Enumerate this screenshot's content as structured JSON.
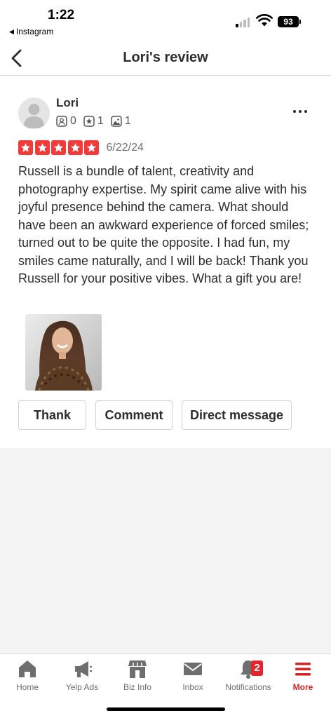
{
  "status_bar": {
    "time": "1:22",
    "back_app": "Instagram",
    "battery": "93"
  },
  "nav": {
    "title": "Lori's review"
  },
  "review": {
    "user_name": "Lori",
    "stats": {
      "friends": "0",
      "reviews": "1",
      "photos": "1"
    },
    "rating": 5,
    "rating_color": "#f43939",
    "date": "6/22/24",
    "text": "Russell is a bundle of talent, creativity and photography expertise. My spirit came alive with his joyful presence behind the camera. What should have been an awkward experience of forced smiles; turned out to be quite the opposite. I had fun, my smiles came naturally, and I will be back! Thank you Russell for your positive vibes. What a gift you are!"
  },
  "actions": {
    "thank": "Thank",
    "comment": "Comment",
    "direct_message": "Direct message"
  },
  "tabs": [
    {
      "label": "Home",
      "icon": "home-icon"
    },
    {
      "label": "Yelp Ads",
      "icon": "megaphone-icon"
    },
    {
      "label": "Biz Info",
      "icon": "storefront-icon"
    },
    {
      "label": "Inbox",
      "icon": "envelope-icon"
    },
    {
      "label": "Notifications",
      "icon": "bell-icon",
      "badge": "2"
    },
    {
      "label": "More",
      "icon": "menu-icon",
      "active": true
    }
  ],
  "accent_color": "#d32323"
}
